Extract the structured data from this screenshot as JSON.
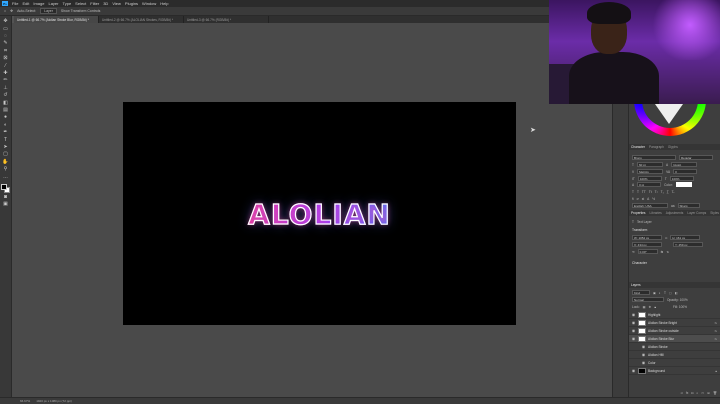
{
  "menubar": {
    "items": [
      "File",
      "Edit",
      "Image",
      "Layer",
      "Type",
      "Select",
      "Filter",
      "3D",
      "View",
      "Plugins",
      "Window",
      "Help"
    ]
  },
  "options": {
    "auto_select": "Auto-Select:",
    "layer": "Layer",
    "show_transform": "Show Transform Controls"
  },
  "tabs": [
    {
      "label": "Untitled-1 @ 66.7% (Alolian Stroke Blur, RGB/8#) *"
    },
    {
      "label": "Untitled-2 @ 66.7% (ALOLIAN Strokes, RGB/8#) *"
    },
    {
      "label": "Untitled-3 @ 66.7% (RGB/8#) *"
    }
  ],
  "canvas": {
    "text": "ALOLIAN"
  },
  "status": {
    "zoom": "66.67%",
    "doc": "1920 px x 1080 px (72 ppi)"
  },
  "character": {
    "tabs": [
      "Character",
      "Paragraph",
      "Glyphs"
    ],
    "font": "Bronx",
    "style": "Regular",
    "size": "60 pt",
    "leading": "(Auto)",
    "tracking": "0",
    "kerning": "Metrics",
    "scale_v": "100%",
    "scale_h": "100%",
    "baseline": "0 pt",
    "color_label": "Color:",
    "language": "English: USA",
    "aa": "Sharp"
  },
  "properties": {
    "tabs": [
      "Properties",
      "Libraries",
      "Adjustments",
      "Layer Comps",
      "Styles"
    ],
    "kind": "Text Layer",
    "transform_label": "Transform",
    "w": "W: 1052 px",
    "h": "H: 161 px",
    "x": "X: 434 px",
    "y": "Y: 459 px",
    "angle": "0.00°",
    "character_label": "Character"
  },
  "layers": {
    "title": "Layers",
    "kind": "Kind",
    "blend": "Normal",
    "opacity": "Opacity: 100%",
    "fill": "Fill: 100%",
    "items": [
      {
        "name": "Highlight",
        "thumb": "white"
      },
      {
        "name": "Alolian Stroke Bright",
        "thumb": "white"
      },
      {
        "name": "Alolian Stroke outside",
        "thumb": "white"
      },
      {
        "name": "Alolian Stroke Blur",
        "thumb": "white",
        "selected": true
      },
      {
        "name": "Alolian Stroke",
        "thumb": "none",
        "sub": true
      },
      {
        "name": "Alolian Hfill",
        "thumb": "none",
        "sub": true
      },
      {
        "name": "Color",
        "thumb": "none",
        "sub": true
      },
      {
        "name": "Background",
        "thumb": "black"
      }
    ]
  },
  "colors": {
    "accent": "#31a8ff",
    "neon_start": "#ff9a2e",
    "neon_end": "#19e6a8"
  }
}
